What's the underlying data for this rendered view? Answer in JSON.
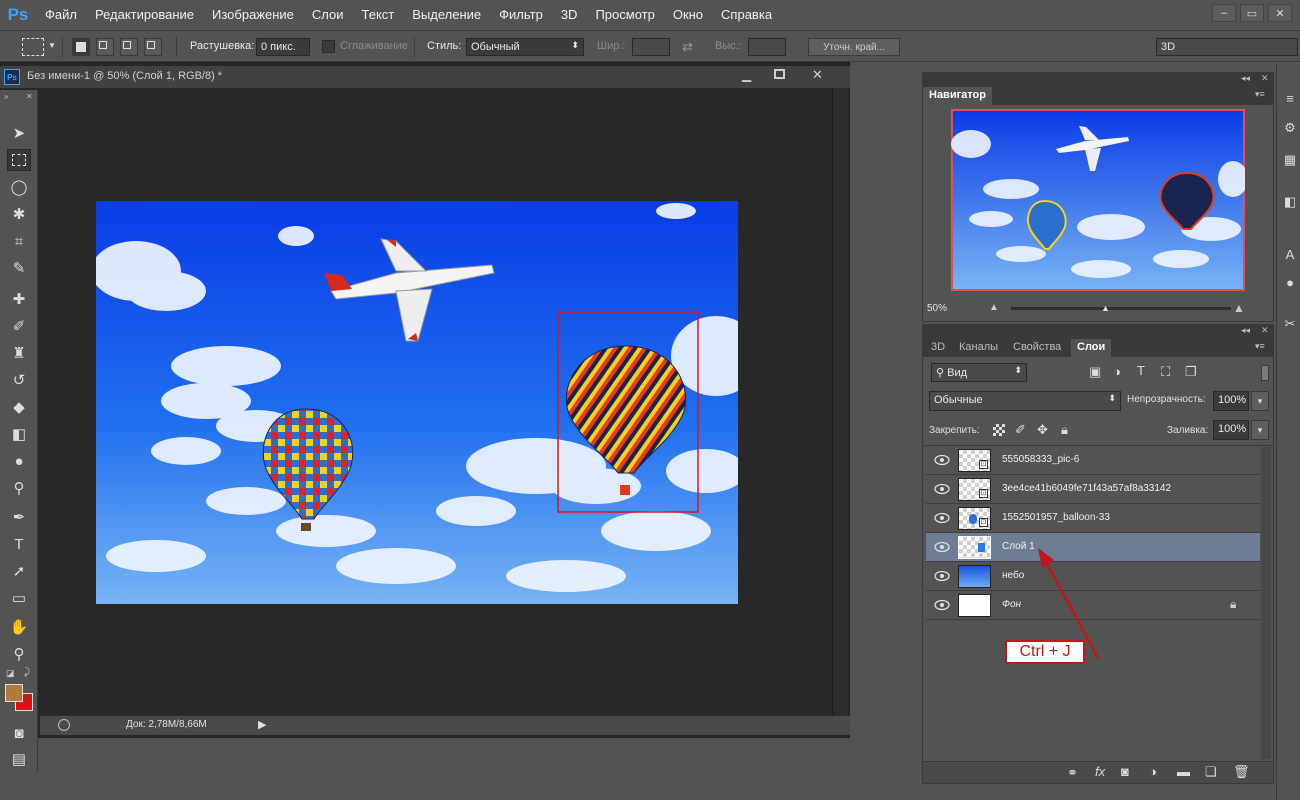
{
  "app": {
    "logo": "Ps",
    "menu": [
      "Файл",
      "Редактирование",
      "Изображение",
      "Слои",
      "Текст",
      "Выделение",
      "Фильтр",
      "3D",
      "Просмотр",
      "Окно",
      "Справка"
    ],
    "window_controls": [
      "–",
      "▭",
      "✕"
    ]
  },
  "options": {
    "feather_label": "Растушевка:",
    "feather_value": "0 пикс.",
    "antialias_label": "Сглаживание",
    "style_label": "Стиль:",
    "style_value": "Обычный",
    "width_label": "Шир.:",
    "height_label": "Выс.:",
    "refine_button": "Уточн. край...",
    "workspace": "3D"
  },
  "document": {
    "tab_icon": "Ps",
    "title": "Без имени-1 @ 50% (Слой 1, RGB/8) *",
    "status": "Док: 2,78M/8,66M"
  },
  "navigator": {
    "tab": "Навигатор",
    "zoom": "50%"
  },
  "layers_panel": {
    "tabs": [
      "3D",
      "Каналы",
      "Свойства",
      "Слои"
    ],
    "active_tab": "Слои",
    "filter_kind": "Вид",
    "blend_mode": "Обычные",
    "opacity_label": "Непрозрачность:",
    "opacity_value": "100%",
    "lock_label": "Закрепить:",
    "fill_label": "Заливка:",
    "fill_value": "100%",
    "layers": [
      {
        "name": "555058333_pic-6",
        "selected": false,
        "locked": false
      },
      {
        "name": "3ee4ce41b6049fe71f43a57af8a33142",
        "selected": false,
        "locked": false
      },
      {
        "name": "1552501957_balloon-33",
        "selected": false,
        "locked": false
      },
      {
        "name": "Слой 1",
        "selected": true,
        "locked": false
      },
      {
        "name": "небо",
        "selected": false,
        "locked": false
      },
      {
        "name": "Фон",
        "selected": false,
        "locked": true
      }
    ]
  },
  "annotation": {
    "text": "Ctrl + J",
    "color": "#c0171a"
  },
  "colors": {
    "foreground": "#b07a3a",
    "background": "#d01515",
    "selection_frame": "#d01a1a"
  }
}
